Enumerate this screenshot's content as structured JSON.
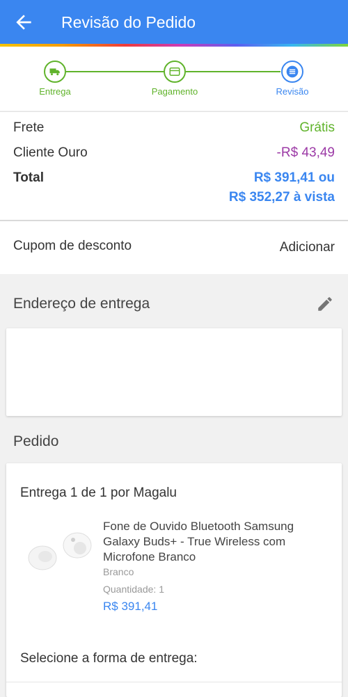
{
  "header": {
    "title": "Revisão do Pedido",
    "back_icon": "arrow-left-icon"
  },
  "colors": {
    "primary": "#3a86f0",
    "success": "#60b32b",
    "discount": "#9c3aa6"
  },
  "stepper": {
    "steps": [
      {
        "label": "Entrega",
        "icon": "truck-icon",
        "state": "done"
      },
      {
        "label": "Pagamento",
        "icon": "card-icon",
        "state": "done"
      },
      {
        "label": "Revisão",
        "icon": "list-icon",
        "state": "active"
      }
    ]
  },
  "summary": {
    "shipping_label": "Frete",
    "shipping_value": "Grátis",
    "member_label": "Cliente Ouro",
    "member_value": "-R$ 43,49",
    "total_label": "Total",
    "total_value_1": "R$ 391,41 ou",
    "total_value_2": "R$ 352,27 à vista"
  },
  "coupon": {
    "label": "Cupom de desconto",
    "action": "Adicionar"
  },
  "address": {
    "title": "Endereço de entrega",
    "edit_icon": "pencil-icon"
  },
  "order": {
    "title": "Pedido",
    "delivery_title": "Entrega 1 de 1 por Magalu",
    "product": {
      "name": "Fone de Ouvido Bluetooth Samsung Galaxy Buds+ - True Wireless com Microfone Branco",
      "variant": "Branco",
      "quantity_label": "Quantidade:",
      "quantity": "1",
      "price": "R$ 391,41"
    },
    "select_delivery": "Selecione a forma de entrega:"
  }
}
